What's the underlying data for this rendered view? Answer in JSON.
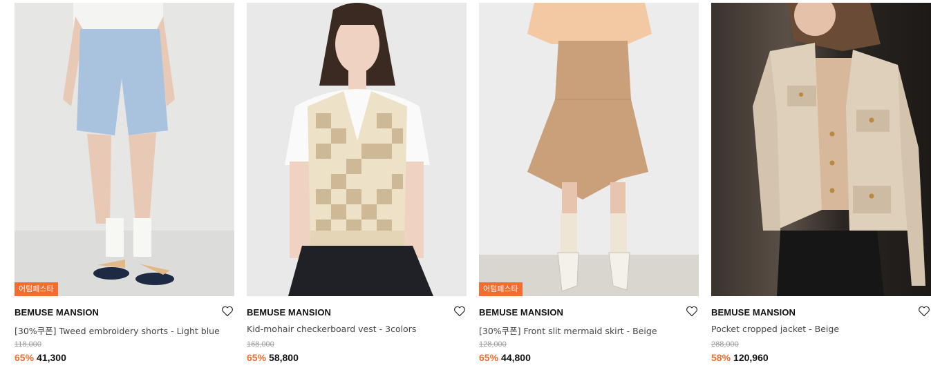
{
  "products": [
    {
      "brand": "BEMUSE MANSION",
      "title": "[30%쿠폰] Tweed embroidery shorts - Light blue",
      "original_price": "118,000",
      "discount": "65%",
      "price": "41,300",
      "badge": "어텀페스타",
      "image": "model in light blue tweed shorts with white socks and sandals",
      "favorite_icon": "heart-outline-icon"
    },
    {
      "brand": "BEMUSE MANSION",
      "title": "Kid-mohair checkerboard vest - 3colors",
      "original_price": "168,000",
      "discount": "65%",
      "price": "58,800",
      "badge": "",
      "image": "model in beige checkerboard knit vest and black skirt",
      "favorite_icon": "heart-outline-icon"
    },
    {
      "brand": "BEMUSE MANSION",
      "title": "[30%쿠폰] Front slit mermaid skirt - Beige",
      "original_price": "128,000",
      "discount": "65%",
      "price": "44,800",
      "badge": "어텀페스타",
      "image": "model in beige mermaid skirt with cream boots",
      "favorite_icon": "heart-outline-icon"
    },
    {
      "brand": "BEMUSE MANSION",
      "title": "Pocket cropped jacket - Beige",
      "original_price": "288,000",
      "discount": "58%",
      "price": "120,960",
      "badge": "",
      "image": "model in beige wool cropped jacket with gold buttons",
      "favorite_icon": "heart-outline-icon"
    }
  ],
  "colors": {
    "accent": "#f26d2e",
    "text": "#111111",
    "muted": "#999999"
  }
}
